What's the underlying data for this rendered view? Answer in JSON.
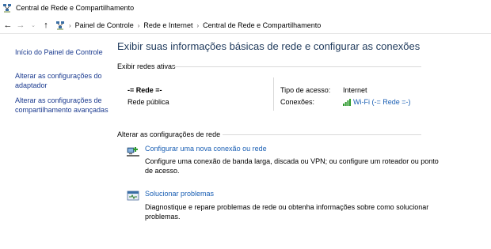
{
  "window": {
    "title": "Central de Rede e Compartilhamento",
    "icon": "network-center-icon"
  },
  "address": {
    "back_icon": "back-arrow-icon",
    "forward_icon": "forward-arrow-icon",
    "recent_icon": "chevron-down-icon",
    "up_icon": "up-arrow-icon",
    "breadcrumbs": [
      "Painel de Controle",
      "Rede e Internet",
      "Central de Rede e Compartilhamento"
    ]
  },
  "sidebar": {
    "items": [
      {
        "label": "Início do Painel de Controle"
      },
      {
        "label": "Alterar as configurações do adaptador"
      },
      {
        "label": "Alterar as configurações de compartilhamento avançadas"
      }
    ]
  },
  "main": {
    "title": "Exibir suas informações básicas de rede e configurar as conexões",
    "active_section": "Exibir redes ativas",
    "network": {
      "name": "-= Rede =-",
      "type": "Rede pública",
      "access_label": "Tipo de acesso:",
      "access_value": "Internet",
      "connections_label": "Conexões:",
      "connection_value": "Wi-Fi (-= Rede =-)"
    },
    "change_section": "Alterar as configurações de rede",
    "tasks": [
      {
        "icon": "new-connection-icon",
        "link": "Configurar uma nova conexão ou rede",
        "description": "Configure uma conexão de banda larga, discada ou VPN; ou configure um roteador ou ponto de acesso."
      },
      {
        "icon": "troubleshoot-icon",
        "link": "Solucionar problemas",
        "description": "Diagnostique e repare problemas de rede ou obtenha informações sobre como solucionar problemas."
      }
    ]
  },
  "colors": {
    "link": "#1a5fb4",
    "sidebar_link": "#1a3a8f",
    "title": "#1e395b",
    "wifi_bars": "#2e9a2e"
  }
}
